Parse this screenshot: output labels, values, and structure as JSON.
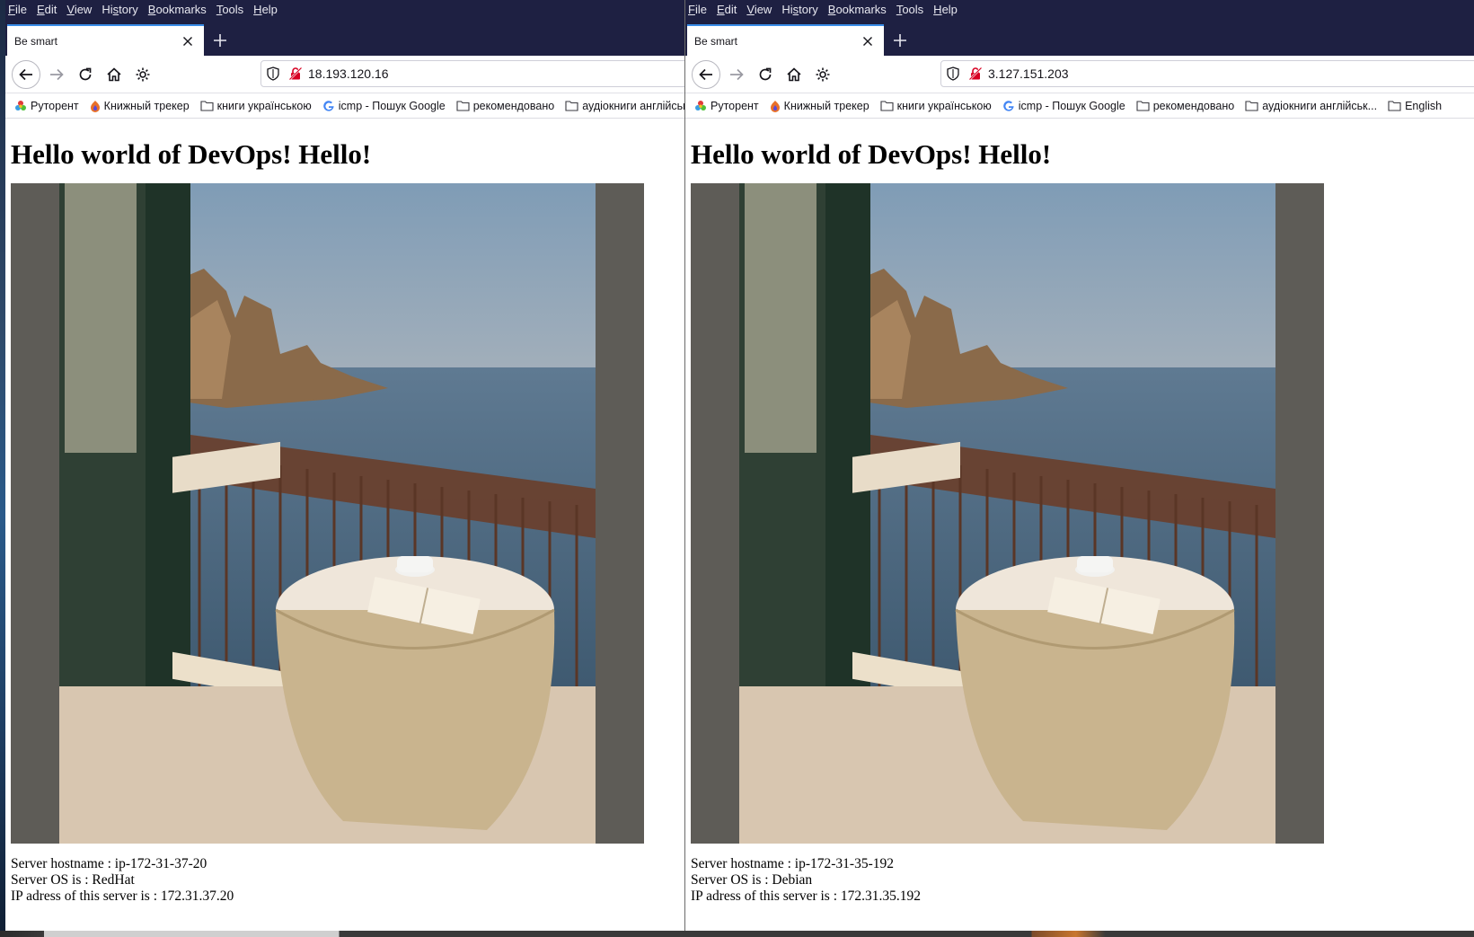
{
  "menu": [
    "File",
    "Edit",
    "View",
    "History",
    "Bookmarks",
    "Tools",
    "Help"
  ],
  "menu_underline": [
    "F",
    "E",
    "V",
    "s",
    "B",
    "T",
    "H"
  ],
  "bookmarks": [
    {
      "label": "Руторент",
      "icon": "rutorrent-icon"
    },
    {
      "label": "Книжный трекер",
      "icon": "book-tracker-icon"
    },
    {
      "label": "книги українською",
      "icon": "folder-icon"
    },
    {
      "label": "icmp - Пошук Google",
      "icon": "google-icon"
    },
    {
      "label": "рекомендовано",
      "icon": "folder-icon"
    },
    {
      "label": "аудіокниги англійськ...",
      "icon": "folder-icon"
    },
    {
      "label": "English",
      "icon": "folder-icon"
    }
  ],
  "windows": [
    {
      "tab_title": "Be smart",
      "url": "18.193.120.16",
      "heading": "Hello world of DevOps! Hello!",
      "hostname_line": "Server hostname : ip-172-31-37-20",
      "os_line": "Server OS is : RedHat",
      "ip_line": "IP adress of this server is : 172.31.37.20"
    },
    {
      "tab_title": "Be smart",
      "url": "3.127.151.203",
      "heading": "Hello world of DevOps! Hello!",
      "hostname_line": "Server hostname : ip-172-31-35-192",
      "os_line": "Server OS is : Debian",
      "ip_line": "IP adress of this server is : 172.31.35.192"
    }
  ],
  "colors": {
    "chrome_bg": "#1e2042",
    "tab_accent": "#3a8de8",
    "photo_frame": "#5e5c57"
  }
}
